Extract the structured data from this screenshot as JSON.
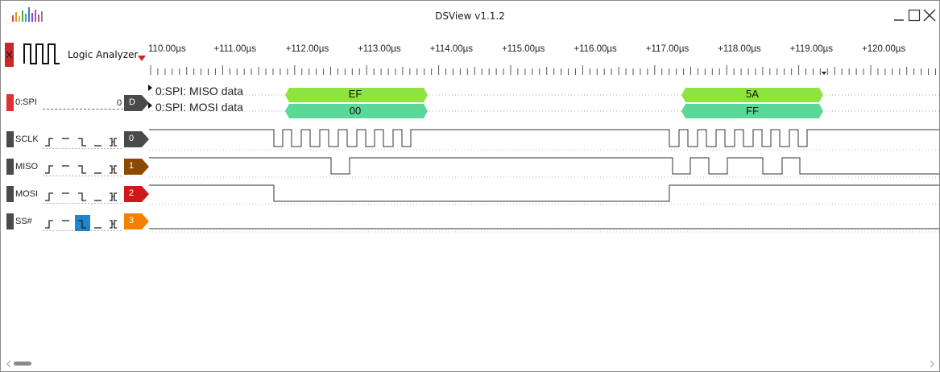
{
  "window": {
    "title": "DSView v1.1.2",
    "controls": [
      "minimize",
      "maximize",
      "close"
    ]
  },
  "toolbar": {
    "device_label": "Logic Analyzer"
  },
  "ruler": {
    "ticks": [
      "110.00µs",
      "+111.00µs",
      "+112.00µs",
      "+113.00µs",
      "+114.00µs",
      "+115.00µs",
      "+116.00µs",
      "+117.00µs",
      "+118.00µs",
      "+119.00µs",
      "+120.00µs"
    ]
  },
  "decoder": {
    "name": "0:SPI",
    "value": "0",
    "label": "D",
    "rows": [
      {
        "title": "0:SPI: MISO data",
        "annotations": [
          "EF",
          "5A"
        ]
      },
      {
        "title": "0:SPI: MOSI data",
        "annotations": [
          "00",
          "FF"
        ]
      }
    ]
  },
  "channels": [
    {
      "name": "SCLK",
      "index": "0",
      "color": "#4a4a4a"
    },
    {
      "name": "MISO",
      "index": "1",
      "color": "#8b4a00"
    },
    {
      "name": "MOSI",
      "index": "2",
      "color": "#d0171b"
    },
    {
      "name": "SS#",
      "index": "3",
      "color": "#f28100"
    }
  ],
  "trigger_options": [
    "rising",
    "high",
    "falling",
    "low",
    "any-edge"
  ],
  "colors": {
    "decoder_marker": "#d32f2f",
    "pill_miso": "#8fe33f",
    "pill_mosi": "#5ad897",
    "selected_trigger": "#1c86d0"
  }
}
